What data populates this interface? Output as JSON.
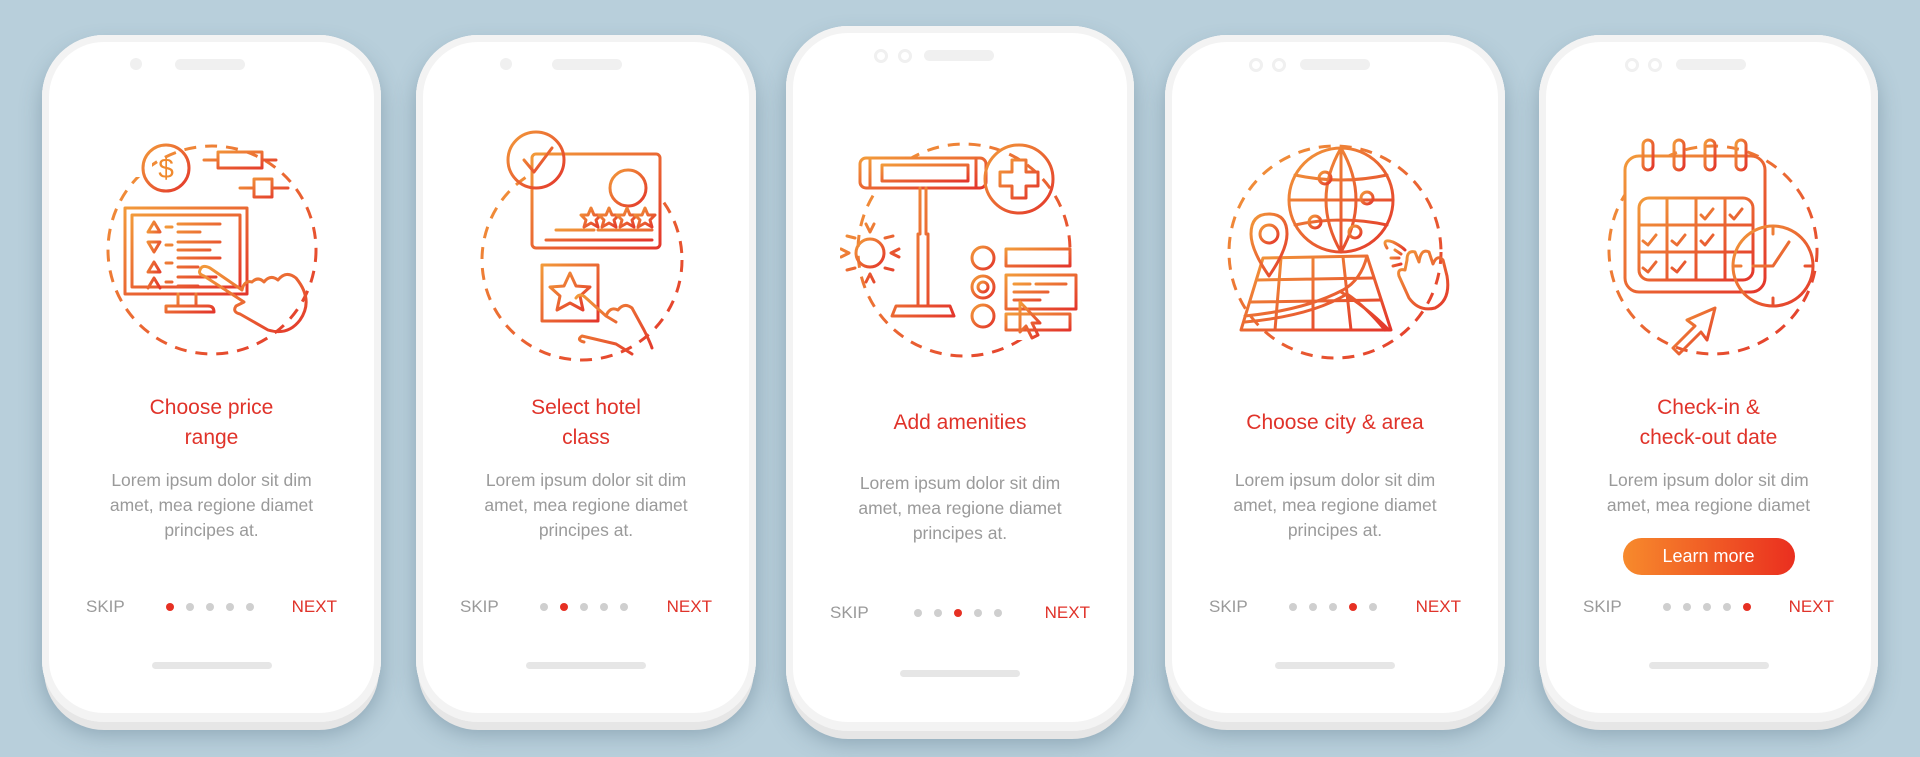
{
  "screens": [
    {
      "title": "Choose price range",
      "title_lines": [
        "Choose price",
        "range"
      ],
      "body_lines": [
        "Lorem ipsum dolor sit dim",
        "amet, mea regione diamet",
        "principes at."
      ],
      "skip_label": "SKIP",
      "next_label": "NEXT",
      "active_step": 1,
      "icon": "price-range-monitor-icon"
    },
    {
      "title": "Select hotel class",
      "title_lines": [
        "Select hotel",
        "class"
      ],
      "body_lines": [
        "Lorem ipsum dolor sit dim",
        "amet, mea regione diamet",
        "principes at."
      ],
      "skip_label": "SKIP",
      "next_label": "NEXT",
      "active_step": 2,
      "icon": "hotel-rating-star-icon"
    },
    {
      "title": "Add amenities",
      "title_lines": [
        "Add amenities"
      ],
      "body_lines": [
        "Lorem ipsum dolor sit dim",
        "amet, mea regione diamet",
        "principes at."
      ],
      "skip_label": "SKIP",
      "next_label": "NEXT",
      "active_step": 3,
      "icon": "amenities-heater-icon"
    },
    {
      "title": "Choose city & area",
      "title_lines": [
        "Choose city & area"
      ],
      "body_lines": [
        "Lorem ipsum dolor sit dim",
        "amet, mea regione diamet",
        "principes at."
      ],
      "skip_label": "SKIP",
      "next_label": "NEXT",
      "active_step": 4,
      "icon": "globe-map-icon"
    },
    {
      "title": "Check-in & check-out date",
      "title_lines": [
        "Check-in &",
        "check-out date"
      ],
      "body_lines": [
        "Lorem ipsum dolor sit dim",
        "amet, mea regione diamet"
      ],
      "cta_label": "Learn more",
      "skip_label": "SKIP",
      "next_label": "NEXT",
      "active_step": 5,
      "icon": "calendar-clock-icon"
    }
  ],
  "total_steps": 5,
  "colors": {
    "background": "#b8cfdb",
    "title": "#e0332a",
    "body_text": "#9a9a9a",
    "dot_active": "#e63023",
    "dot_inactive": "#cfcfcf",
    "icon_gradient_start": "#f08a2e",
    "icon_gradient_end": "#e5392a",
    "cta_gradient_start": "#f78a2c",
    "cta_gradient_end": "#ea2f1f"
  }
}
